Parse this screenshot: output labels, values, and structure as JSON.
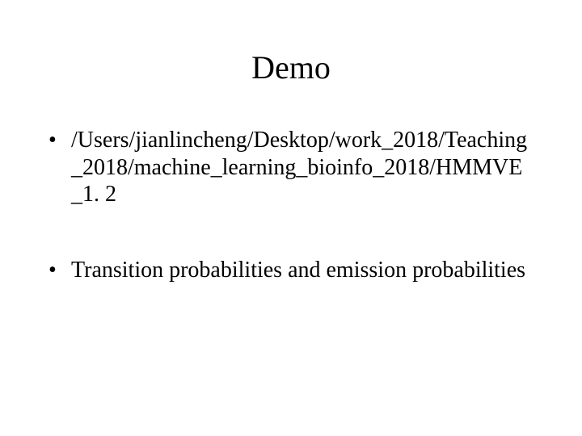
{
  "slide": {
    "title": "Demo",
    "bullets": [
      "/Users/jianlincheng/Desktop/work_2018/Teaching_2018/machine_learning_bioinfo_2018/HMMVE_1. 2",
      "Transition probabilities and emission probabilities"
    ]
  }
}
